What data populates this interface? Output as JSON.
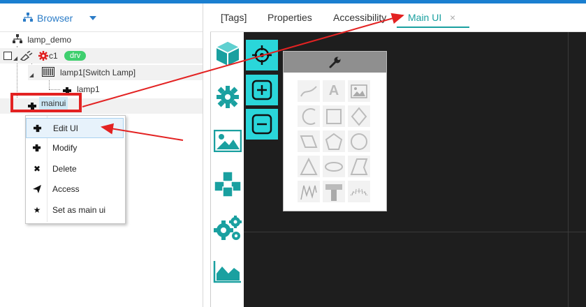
{
  "browser": {
    "title": "Browser"
  },
  "tree": {
    "root": "lamp_demo",
    "channel": "c1",
    "channel_badge": "drv",
    "device": "lamp1[Switch Lamp]",
    "tag": "lamp1",
    "ui": "mainui"
  },
  "context_menu": {
    "items": [
      {
        "label": "Edit UI",
        "icon": "puzzle-icon"
      },
      {
        "label": "Modify",
        "icon": "puzzle-icon"
      },
      {
        "label": "Delete",
        "icon": "close-icon"
      },
      {
        "label": "Access",
        "icon": "send-icon"
      },
      {
        "label": "Set as main ui",
        "icon": "star-icon"
      }
    ]
  },
  "tabs": {
    "items": [
      "[Tags]",
      "Properties",
      "Accessibility",
      "Main UI"
    ],
    "active": "Main UI",
    "close": "×"
  },
  "palette": {
    "text_tool": "A",
    "tools": [
      "line-tool-icon",
      "text-tool-icon",
      "image-tool-icon",
      "arc-tool-icon",
      "rect-tool-icon",
      "diamond-tool-icon",
      "parallelogram-tool-icon",
      "pentagon-tool-icon",
      "circle-tool-icon",
      "triangle-tool-icon",
      "ellipse-tool-icon",
      "trapezoid-tool-icon",
      "wave-tool-icon",
      "pipe-tool-icon",
      "gauge-tool-icon"
    ]
  },
  "colors": {
    "accent": "#2ad6da",
    "teal": "#1aa0a0",
    "highlight_red": "#e32222",
    "canvas": "#1e1e1e"
  }
}
